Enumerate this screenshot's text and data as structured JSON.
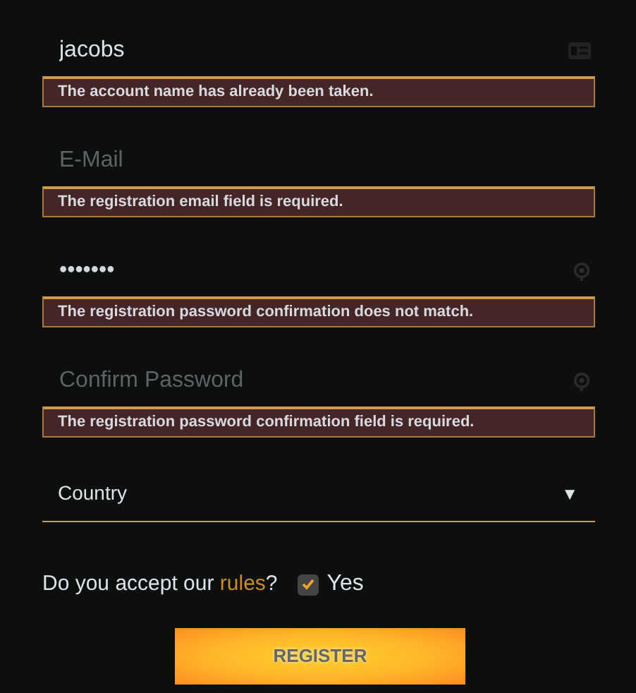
{
  "fields": [
    {
      "kind": "username",
      "value": "jacobs",
      "error": "The account name has already been taken."
    },
    {
      "kind": "email",
      "placeholder": "E-Mail",
      "error": "The registration email field is required."
    },
    {
      "kind": "password",
      "value": "•••••••",
      "error": "The registration password confirmation does not match."
    },
    {
      "kind": "password",
      "placeholder": "Confirm Password",
      "error": "The registration password confirmation field is required."
    }
  ],
  "country": {
    "placeholder": "Country",
    "arrow": "▼"
  },
  "rules": {
    "before": "Do you accept our ",
    "link": "rules",
    "after": "?",
    "checked": true,
    "label": "Yes"
  },
  "submit": "REGISTER"
}
